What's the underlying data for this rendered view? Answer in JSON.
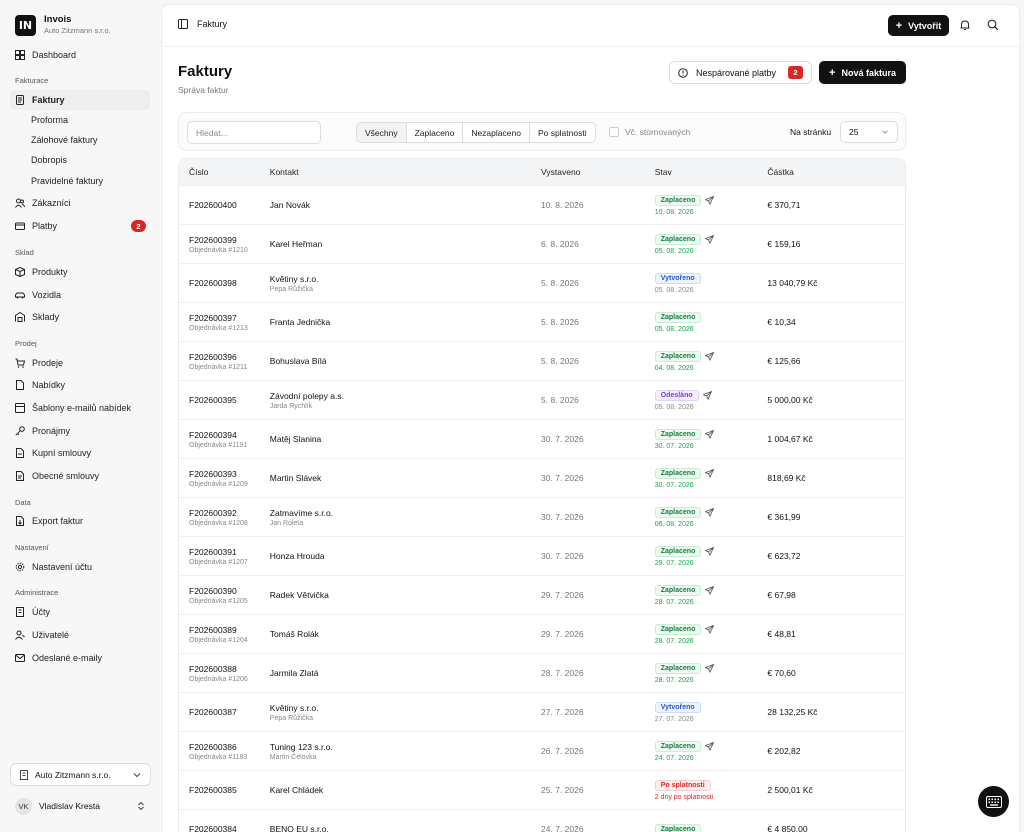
{
  "brand": {
    "name": "Invois",
    "company": "Auto Zitzmann s.r.o.",
    "logo_text": "IN"
  },
  "sidebar": {
    "dashboard": "Dashboard",
    "sections": {
      "fakturace": "Fakturace",
      "sklad": "Sklad",
      "prodej": "Prodej",
      "data": "Data",
      "nastaveni": "Nastavení",
      "administrace": "Administrace"
    },
    "fakturace": [
      "Faktury",
      "Proforma",
      "Zálohové faktury",
      "Dobropis",
      "Pravidelné faktury",
      "Zákazníci",
      "Platby"
    ],
    "platby_badge": "2",
    "sklad": [
      "Produkty",
      "Vozidla",
      "Sklady"
    ],
    "prodej": [
      "Prodeje",
      "Nabídky",
      "Šablony e-mailů nabídek",
      "Pronájmy",
      "Kupní smlouvy",
      "Obecné smlouvy"
    ],
    "data": [
      "Export faktur"
    ],
    "nastaveni": [
      "Nastavení účtu"
    ],
    "administrace": [
      "Účty",
      "Uživatelé",
      "Odeslané e-maily"
    ],
    "company_select": "Auto Zitzmann s.r.o.",
    "user": {
      "initials": "VK",
      "name": "Vladislav Kresta"
    }
  },
  "topbar": {
    "breadcrumb": "Faktury",
    "create_label": "Vytvořit"
  },
  "page": {
    "title": "Faktury",
    "subtitle": "Správa faktur",
    "unmatched_label": "Nespárované platby",
    "unmatched_count": "2",
    "new_invoice_label": "Nová faktura"
  },
  "filters": {
    "search_placeholder": "Hledat...",
    "segments": [
      "Všechny",
      "Zaplaceno",
      "Nezaplaceno",
      "Po splatnosti"
    ],
    "include_cancelled": "Vč. stornovaných",
    "per_page_label": "Na stránku",
    "per_page_value": "25"
  },
  "table": {
    "headers": [
      "Číslo",
      "Kontakt",
      "Vystaveno",
      "Stav",
      "Částka"
    ],
    "rows": [
      {
        "number": "F202600400",
        "order": "",
        "contact": "Jan Novák",
        "contact_sub": "",
        "issued": "10. 8. 2026",
        "status": "Zaplaceno",
        "kind": "paid",
        "status_date": "10. 08. 2026",
        "sent": true,
        "amount": "€ 370,71"
      },
      {
        "number": "F202600399",
        "order": "Objednávka #1210",
        "contact": "Karel Heřman",
        "contact_sub": "",
        "issued": "6. 8. 2026",
        "status": "Zaplaceno",
        "kind": "paid",
        "status_date": "05. 08. 2026",
        "sent": true,
        "amount": "€ 159,16"
      },
      {
        "number": "F202600398",
        "order": "",
        "contact": "Květiny s.r.o.",
        "contact_sub": "Pepa Růžička",
        "issued": "5. 8. 2026",
        "status": "Vytvořeno",
        "kind": "created",
        "status_date": "05. 08. 2026",
        "sent": false,
        "amount": "13 040,79 Kč"
      },
      {
        "number": "F202600397",
        "order": "Objednávka #1213",
        "contact": "Franta Jednička",
        "contact_sub": "",
        "issued": "5. 8. 2026",
        "status": "Zaplaceno",
        "kind": "paid",
        "status_date": "05. 08. 2026",
        "sent": false,
        "amount": "€ 10,34"
      },
      {
        "number": "F202600396",
        "order": "Objednávka #1211",
        "contact": "Bohuslava Bílá",
        "contact_sub": "",
        "issued": "5. 8. 2026",
        "status": "Zaplaceno",
        "kind": "paid",
        "status_date": "04. 08. 2026",
        "sent": true,
        "amount": "€ 125,66"
      },
      {
        "number": "F202600395",
        "order": "",
        "contact": "Závodní polepy a.s.",
        "contact_sub": "Jarda Rychlík",
        "issued": "5. 8. 2026",
        "status": "Odesláno",
        "kind": "sent",
        "status_date": "05. 08. 2026",
        "sent": true,
        "amount": "5 000,00 Kč"
      },
      {
        "number": "F202600394",
        "order": "Objednávka #1191",
        "contact": "Matěj Slanina",
        "contact_sub": "",
        "issued": "30. 7. 2026",
        "status": "Zaplaceno",
        "kind": "paid",
        "status_date": "30. 07. 2026",
        "sent": true,
        "amount": "1 004,67 Kč"
      },
      {
        "number": "F202600393",
        "order": "Objednávka #1209",
        "contact": "Martin Slávek",
        "contact_sub": "",
        "issued": "30. 7. 2026",
        "status": "Zaplaceno",
        "kind": "paid",
        "status_date": "30. 07. 2026",
        "sent": true,
        "amount": "818,69 Kč"
      },
      {
        "number": "F202600392",
        "order": "Objednávka #1208",
        "contact": "Zatmavíme s.r.o.",
        "contact_sub": "Jan Roleta",
        "issued": "30. 7. 2026",
        "status": "Zaplaceno",
        "kind": "paid",
        "status_date": "06. 08. 2026",
        "sent": true,
        "amount": "€ 361,99"
      },
      {
        "number": "F202600391",
        "order": "Objednávka #1207",
        "contact": "Honza Hrouda",
        "contact_sub": "",
        "issued": "30. 7. 2026",
        "status": "Zaplaceno",
        "kind": "paid",
        "status_date": "29. 07. 2026",
        "sent": true,
        "amount": "€ 623,72"
      },
      {
        "number": "F202600390",
        "order": "Objednávka #1205",
        "contact": "Radek Větvička",
        "contact_sub": "",
        "issued": "29. 7. 2026",
        "status": "Zaplaceno",
        "kind": "paid",
        "status_date": "28. 07. 2026",
        "sent": true,
        "amount": "€ 67,98"
      },
      {
        "number": "F202600389",
        "order": "Objednávka #1204",
        "contact": "Tomáš Rolák",
        "contact_sub": "",
        "issued": "29. 7. 2026",
        "status": "Zaplaceno",
        "kind": "paid",
        "status_date": "28. 07. 2026",
        "sent": true,
        "amount": "€ 48,81"
      },
      {
        "number": "F202600388",
        "order": "Objednávka #1206",
        "contact": "Jarmila Zlatá",
        "contact_sub": "",
        "issued": "28. 7. 2026",
        "status": "Zaplaceno",
        "kind": "paid",
        "status_date": "28. 07. 2026",
        "sent": true,
        "amount": "€ 70,60"
      },
      {
        "number": "F202600387",
        "order": "",
        "contact": "Květiny s.r.o.",
        "contact_sub": "Pepa Růžička",
        "issued": "27. 7. 2026",
        "status": "Vytvořeno",
        "kind": "created",
        "status_date": "27. 07. 2026",
        "sent": false,
        "amount": "28 132,25 Kč"
      },
      {
        "number": "F202600386",
        "order": "Objednávka #1183",
        "contact": "Tuning 123 s.r.o.",
        "contact_sub": "Martin Čelovka",
        "issued": "26. 7. 2026",
        "status": "Zaplaceno",
        "kind": "paid",
        "status_date": "24. 07. 2026",
        "sent": true,
        "amount": "€ 202,82"
      },
      {
        "number": "F202600385",
        "order": "",
        "contact": "Karel Chládek",
        "contact_sub": "",
        "issued": "25. 7. 2026",
        "status": "Po splatnosti",
        "kind": "overdue",
        "status_date": "2 dny po splatnosti",
        "sent": false,
        "amount": "2 500,01 Kč"
      },
      {
        "number": "F202600384",
        "order": "",
        "contact": "BENO EU s.r.o.",
        "contact_sub": "",
        "issued": "24. 7. 2026",
        "status": "Zaplaceno",
        "kind": "paid",
        "status_date": "",
        "sent": false,
        "amount": "€ 4 850,00"
      }
    ]
  },
  "colors": {
    "accent": "#111111",
    "paid": "#16a34a",
    "created": "#2558c9",
    "sent": "#7c3aed",
    "overdue": "#dc2626"
  }
}
